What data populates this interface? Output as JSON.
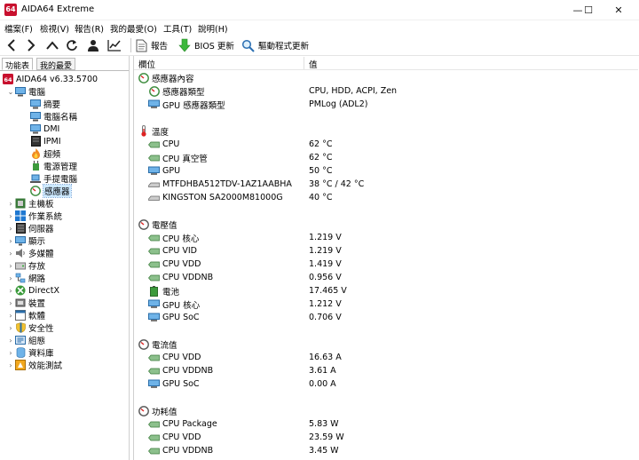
{
  "window": {
    "logo": "64",
    "title": "AIDA64 Extreme",
    "minimize": "—",
    "maximize": "☐",
    "close": "✕"
  },
  "menu": [
    "檔案(F)",
    "檢視(V)",
    "報告(R)",
    "我的最愛(O)",
    "工具(T)",
    "說明(H)"
  ],
  "toolbar": {
    "report": "報告",
    "bios_update": "BIOS 更新",
    "driver_update": "驅動程式更新"
  },
  "left_tabs": [
    "功能表",
    "我的最愛"
  ],
  "tree": {
    "root": "AIDA64 v6.33.5700",
    "computer": "電腦",
    "computer_children": [
      "摘要",
      "電腦名稱",
      "DMI",
      "IPMI",
      "超頻",
      "電源管理",
      "手提電腦",
      "感應器"
    ],
    "top_items": [
      "主機板",
      "作業系統",
      "伺服器",
      "顯示",
      "多媒體",
      "存放",
      "網路",
      "DirectX",
      "裝置",
      "軟體",
      "安全性",
      "組態",
      "資料庫",
      "效能測試"
    ]
  },
  "list": {
    "col_field": "欄位",
    "col_value": "值",
    "sections": [
      {
        "title": "感應器內容",
        "items": [
          {
            "name": "感應器類型",
            "value": "CPU, HDD, ACPI, Zen"
          },
          {
            "name": "GPU 感應器類型",
            "value": "PMLog  (ADL2)"
          }
        ]
      },
      {
        "title": "溫度",
        "items": [
          {
            "name": "CPU",
            "value": "62 °C"
          },
          {
            "name": "CPU 真空管",
            "value": "62 °C"
          },
          {
            "name": "GPU",
            "value": "50 °C"
          },
          {
            "name": "MTFDHBA512TDV-1AZ1AABHA",
            "value": "38 °C / 42 °C"
          },
          {
            "name": "KINGSTON SA2000M81000G",
            "value": "40 °C"
          }
        ]
      },
      {
        "title": "電壓值",
        "items": [
          {
            "name": "CPU 核心",
            "value": "1.219 V"
          },
          {
            "name": "CPU VID",
            "value": "1.219 V"
          },
          {
            "name": "CPU VDD",
            "value": "1.419 V"
          },
          {
            "name": "CPU VDDNB",
            "value": "0.956 V"
          },
          {
            "name": "電池",
            "value": "17.465 V"
          },
          {
            "name": "GPU 核心",
            "value": "1.212 V"
          },
          {
            "name": "GPU SoC",
            "value": "0.706 V"
          }
        ]
      },
      {
        "title": "電流值",
        "items": [
          {
            "name": "CPU VDD",
            "value": "16.63 A"
          },
          {
            "name": "CPU VDDNB",
            "value": "3.61 A"
          },
          {
            "name": "GPU SoC",
            "value": "0.00 A"
          }
        ]
      },
      {
        "title": "功耗值",
        "items": [
          {
            "name": "CPU Package",
            "value": "5.83 W"
          },
          {
            "name": "CPU VDD",
            "value": "23.59 W"
          },
          {
            "name": "CPU VDDNB",
            "value": "3.45 W"
          }
        ]
      }
    ]
  }
}
